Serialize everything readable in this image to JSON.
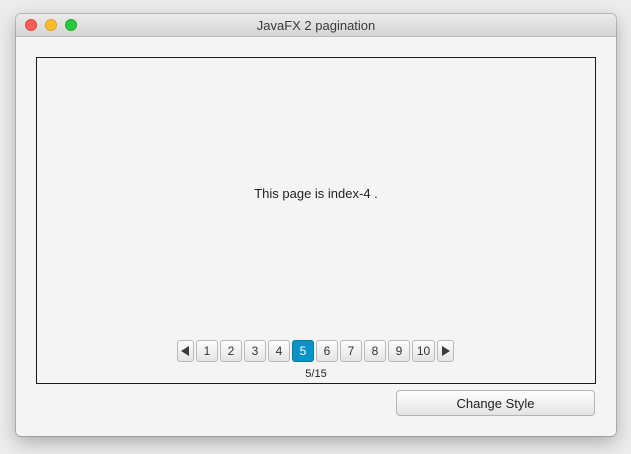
{
  "window": {
    "title": "JavaFX 2 pagination"
  },
  "content": {
    "page_text": "This page is index-4 ."
  },
  "pagination": {
    "pages": [
      "1",
      "2",
      "3",
      "4",
      "5",
      "6",
      "7",
      "8",
      "9",
      "10"
    ],
    "current_page": "5",
    "page_info": "5/15",
    "prev_icon": "triangle-left-icon",
    "next_icon": "triangle-right-icon",
    "accent_color": "#0a93c7"
  },
  "actions": {
    "change_style_label": "Change Style"
  },
  "colors": {
    "close": "#fc5f57",
    "minimize": "#fdbc2e",
    "zoom": "#28c940"
  }
}
